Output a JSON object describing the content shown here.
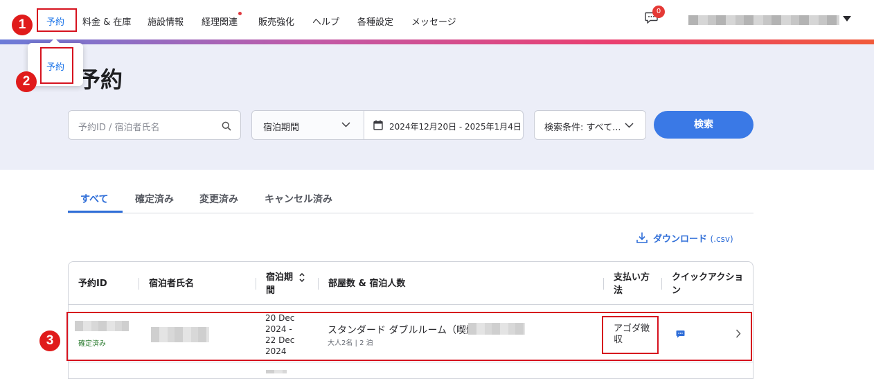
{
  "nav": {
    "items": [
      {
        "label": "予約",
        "active": true
      },
      {
        "label": "料金 & 在庫"
      },
      {
        "label": "施設情報"
      },
      {
        "label": "経理関連"
      },
      {
        "label": "販売強化"
      },
      {
        "label": "ヘルプ"
      },
      {
        "label": "各種設定"
      },
      {
        "label": "メッセージ"
      }
    ],
    "chat_badge": "0",
    "user_icon": "caret-down-icon"
  },
  "dropdown": {
    "item": "予約"
  },
  "page": {
    "title": "予約"
  },
  "filters": {
    "search_placeholder": "予約ID / 宿泊者氏名",
    "period_select": "宿泊期間",
    "date_range": "2024年12月20日 - 2025年1月4日",
    "conditions_select": "検索条件: すべて...",
    "search_button": "検索"
  },
  "tabs": [
    "すべて",
    "確定済み",
    "変更済み",
    "キャンセル済み"
  ],
  "download": {
    "label": "ダウンロード",
    "suffix": "(.csv)"
  },
  "table": {
    "headers": {
      "id": "予約ID",
      "guest": "宿泊者氏名",
      "period_line1": "宿泊期",
      "period_line2": "間",
      "room": "部屋数 & 宿泊人数",
      "payment_line1": "支払い方",
      "payment_line2": "法",
      "action_line1": "クイックアクショ",
      "action_line2": "ン"
    },
    "row": {
      "status": "確定済み",
      "dates": [
        "20 Dec",
        "2024 -",
        "22 Dec",
        "2024"
      ],
      "room": "スタンダード ダブルルーム（喫煙）",
      "room_sub": "大人2名 | 2 泊",
      "payment_line1": "アゴダ徴",
      "payment_line2": "収"
    }
  },
  "markers": [
    "1",
    "2",
    "3"
  ],
  "colors": {
    "accent": "#2f6ed8",
    "callout": "#d6121e",
    "status_green": "#2e7d32"
  }
}
